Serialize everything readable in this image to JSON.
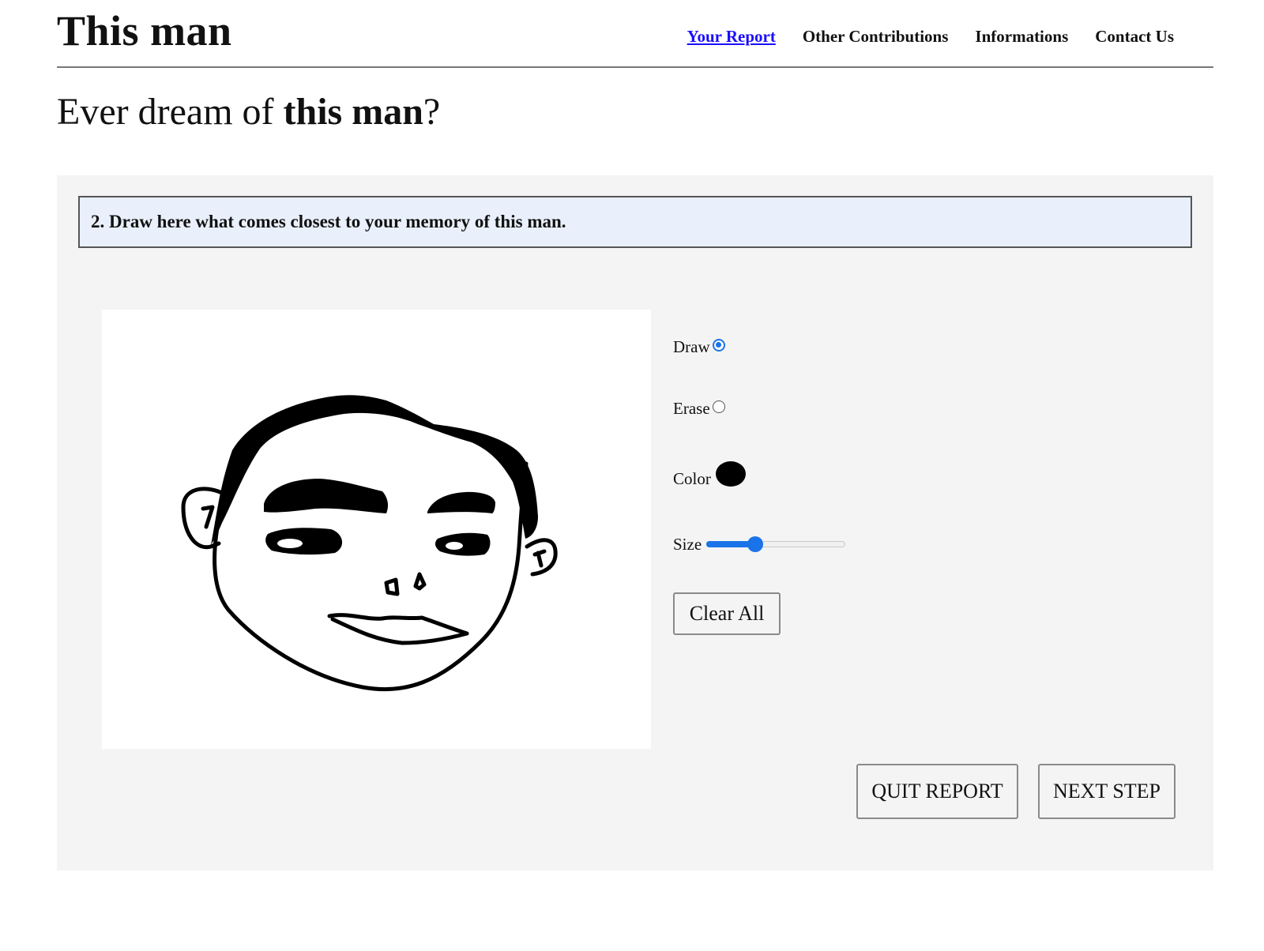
{
  "site": {
    "title": "This man"
  },
  "nav": {
    "items": [
      {
        "label": "Your Report",
        "active": true
      },
      {
        "label": "Other Contributions",
        "active": false
      },
      {
        "label": "Informations",
        "active": false
      },
      {
        "label": "Contact Us",
        "active": false
      }
    ]
  },
  "headline": {
    "prefix": "Ever dream of ",
    "emphasis": "this man",
    "suffix": "?"
  },
  "step": {
    "instruction": "2. Draw here what comes closest to your memory of this man."
  },
  "tools": {
    "draw_label": "Draw",
    "draw_selected": true,
    "erase_label": "Erase",
    "erase_selected": false,
    "color_label": "Color",
    "color_value": "#000000",
    "size_label": "Size",
    "size_fraction": 0.35,
    "clear_label": "Clear All"
  },
  "actions": {
    "quit_label": "QUIT REPORT",
    "next_label": "NEXT STEP"
  },
  "colors": {
    "accent": "#1a73e8",
    "link": "#1a0dff",
    "panel": "#f4f4f4",
    "instruction_bg": "#e9f0fb"
  }
}
